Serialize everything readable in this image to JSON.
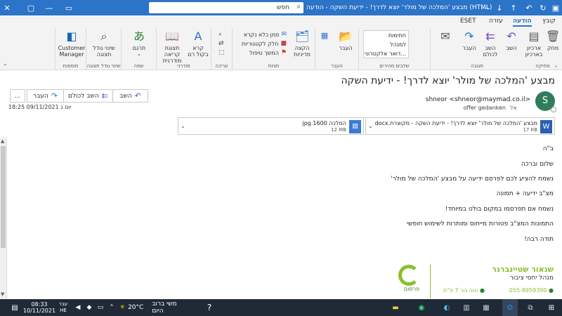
{
  "titlebar": {
    "window_title": "מבצע 'המלכה של מולר' יוצא לדרך! - ידיעת השקה - הודעה (HTML)",
    "search_placeholder": "חפש"
  },
  "tabs": [
    "קובץ",
    "הודעה",
    "עזרה",
    "ESET"
  ],
  "active_tab": "הודעה",
  "ribbon": {
    "groups": {
      "delete": "מחיקה",
      "respond": "תגובה",
      "quick_steps": "שלבים מהירים",
      "move": "העבר",
      "tags": "תגיות",
      "editing": "עריכה",
      "immersive": "מודרני",
      "language": "שפה",
      "zoom": "שינוי גודל תצוגה",
      "addins": "תוספות"
    },
    "buttons": {
      "delete": "מחק",
      "archive": "ארכיון בארכיון",
      "reply": "השב",
      "reply_all": "השב לכולם",
      "forward": "העבר",
      "move": "העבר",
      "policies": "הקצה מדיניות",
      "read_aloud": "קרא בקול רם",
      "immersive_reader": "תצוגת קריאה מודרנית",
      "translate": "תרגם",
      "zoom": "שינוי גודל תצוגה",
      "customer_manager": "Customer Manager",
      "mark_unread": "סמן כלא נקרא",
      "categorize": "חלק לקטגוריות",
      "follow_up": "המשך טיפול"
    },
    "quick_steps": [
      "חתימות",
      "למנהל",
      "דואר אלקטרוני..."
    ]
  },
  "message": {
    "subject": "מבצע 'המלכה של מולר' יוצא לדרך! - ידיעת השקה",
    "reply_label": "השב",
    "reply_all_label": "השב לכולם",
    "forward_label": "העבר",
    "more_label": "...",
    "avatar_letter": "S",
    "sender": "shneor <shneor@maymad.co.il>",
    "to_label": "אל",
    "to": "offer gedanken",
    "datetime": "יום ג 09/11/2021 18:25",
    "attachments": [
      {
        "name": "מבצע 'המלכה של מולר' יוצא לדרך! - ידיעת השקה - מקוצרת.docx",
        "size": "17 KB",
        "type": "W"
      },
      {
        "name": "המלכה 1600.jpg",
        "size": "12 MB",
        "type": "img"
      }
    ],
    "body": [
      "ב\"ה",
      "שלום וברכה",
      "נשמח להציע לכם לפרסם ידיעה על מבצע 'המלכה של מולר'",
      "מצ\"ב ידיעה + תמונה",
      "נשמח אם תפרסמו במקום בולט במיוחד!",
      "התמונות המצ\"ב פטורות מייחוס ומותרות לשימוש חופשי",
      "תודה רבה!"
    ],
    "signature": {
      "name": "שנאור שטיינברגר",
      "title": "מנהל יחסי ציבור",
      "phone": "055-8959390",
      "address": "נווה גור 7 פ\"ת",
      "logo_text": "פרסום"
    }
  },
  "taskbar": {
    "weather": "20°C",
    "weather_text": "משי ברוב היום",
    "time": "08:33",
    "date": "10/11/2021",
    "lang_top": "עבר",
    "lang_bottom": "HE"
  }
}
